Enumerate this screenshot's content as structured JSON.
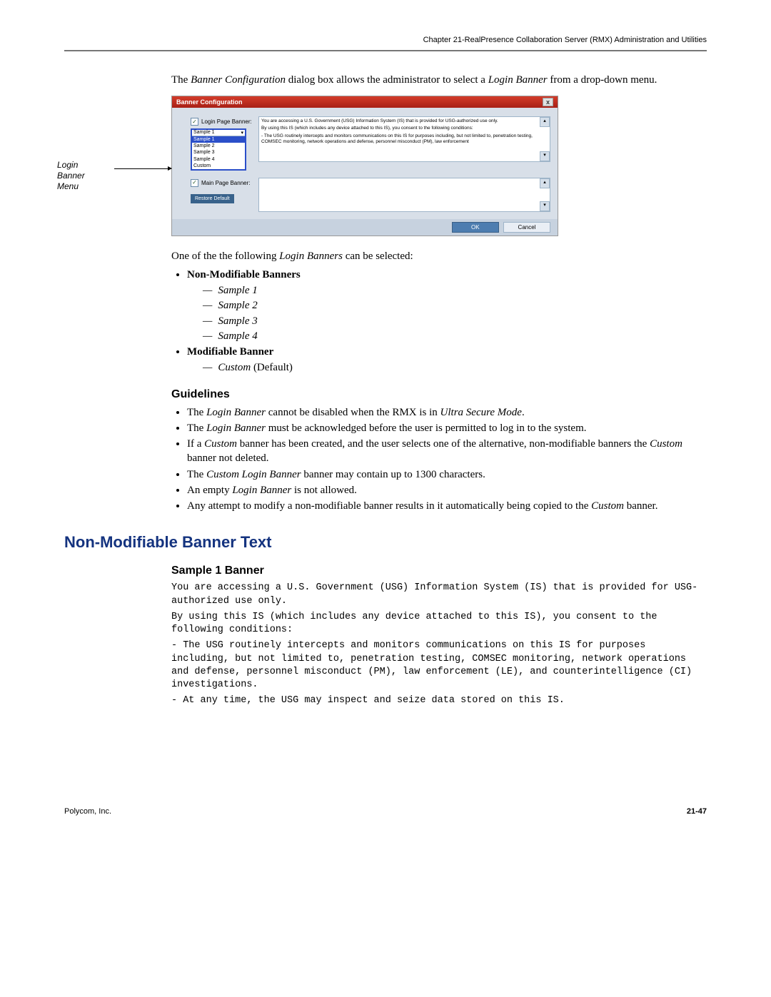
{
  "header": {
    "chapter": "Chapter 21-RealPresence Collaboration Server (RMX) Administration and Utilities"
  },
  "intro": {
    "p1_a": "The ",
    "p1_b": "Banner Configuration",
    "p1_c": " dialog box allows the administrator to select a ",
    "p1_d": "Login Banner",
    "p1_e": " from a drop-down menu."
  },
  "figure": {
    "label_l1": "Login",
    "label_l2": "Banner",
    "label_l3": "Menu"
  },
  "dialog": {
    "title": "Banner Configuration",
    "close": "x",
    "login_chk": "Login Page Banner:",
    "main_chk": "Main Page Banner:",
    "dd_selected": "Sample 1",
    "opts": [
      "Sample 1",
      "Sample 2",
      "Sample 3",
      "Sample 4",
      "Custom"
    ],
    "restore": "Restore Default",
    "text_l1": "You are accessing a U.S. Government (USG) Information System (IS) that is provided for USG-authorized use only.",
    "text_l2": "By using this IS (which includes any device attached to this IS), you consent to the following conditions:",
    "text_l3": "- The USG routinely intercepts and monitors communications on this IS for purposes including, but not limited to, penetration testing, COMSEC monitoring, network operations and defense, personnel misconduct (PM), law enforcement",
    "ok": "OK",
    "cancel": "Cancel"
  },
  "after_fig": {
    "p_a": "One of the the following ",
    "p_b": "Login Banners",
    "p_c": " can be selected:"
  },
  "list": {
    "h1": "Non-Modifiable Banners",
    "s1": "Sample 1",
    "s2": "Sample 2",
    "s3": "Sample 3",
    "s4": "Sample 4",
    "h2": "Modifiable Banner",
    "custom_i": "Custom",
    "custom_r": " (Default)"
  },
  "guidelines": {
    "title": "Guidelines",
    "g1_a": "The ",
    "g1_b": "Login Banner",
    "g1_c": " cannot be disabled when the RMX is in ",
    "g1_d": "Ultra Secure Mode",
    "g1_e": ".",
    "g2_a": "The ",
    "g2_b": "Login Banner",
    "g2_c": " must be acknowledged before the user is permitted to log in to the system.",
    "g3_a": "If a ",
    "g3_b": "Custom",
    "g3_c": " banner has been created, and the user selects one of the alternative, non-modifiable banners the ",
    "g3_d": "Custom",
    "g3_e": " banner not deleted.",
    "g4_a": "The ",
    "g4_b": "Custom Login Banner",
    "g4_c": " banner may contain up to 1300 characters.",
    "g5_a": "An empty ",
    "g5_b": "Login Banner",
    "g5_c": " is not allowed.",
    "g6_a": "Any attempt to modify a non-modifiable banner results in it automatically being copied to the ",
    "g6_b": "Custom",
    "g6_c": " banner."
  },
  "section2": {
    "title": "Non-Modifiable Banner Text",
    "sub": "Sample 1 Banner",
    "m1": "You are accessing a U.S. Government (USG) Information System (IS) that is provided for USG-authorized use only.",
    "m2": "By using this IS (which includes any device attached to this IS), you consent to the following conditions:",
    "m3": "- The USG routinely intercepts and monitors communications on this IS for purposes including, but not limited to, penetration testing, COMSEC monitoring, network operations and defense,  personnel misconduct (PM), law enforcement (LE), and counterintelligence (CI) investigations.",
    "m4": "- At any time, the USG may inspect and seize data stored on this IS."
  },
  "footer": {
    "left": "Polycom, Inc.",
    "right": "21-47"
  }
}
